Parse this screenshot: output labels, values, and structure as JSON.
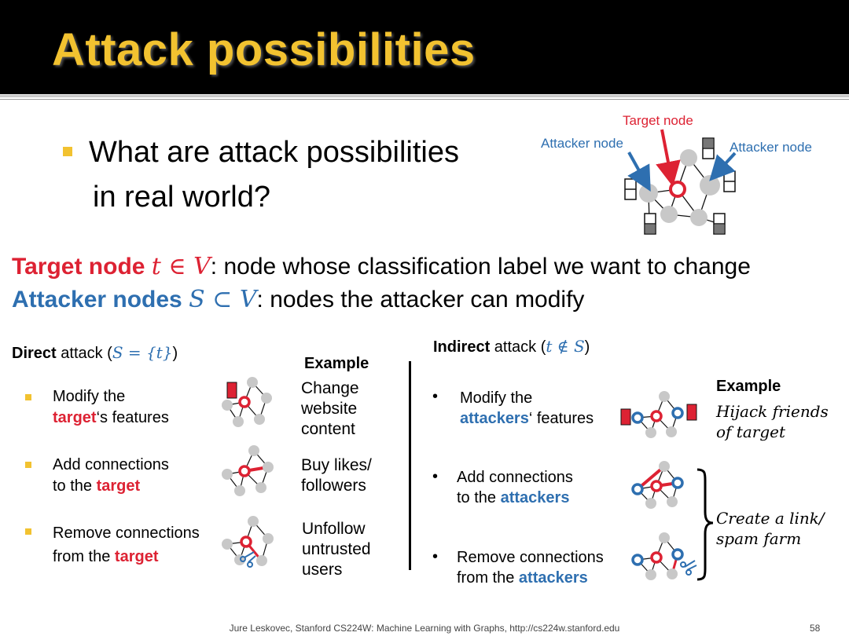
{
  "title": "Attack possibilities",
  "question": {
    "line1": "What are attack possibilities",
    "line2": "in real world?"
  },
  "diagram": {
    "target_label": "Target node",
    "attacker_left": "Attacker node",
    "attacker_right": "Attacker node"
  },
  "definitions": {
    "target": {
      "term": "Target node",
      "math": "t ∈ V",
      "rest": ": node whose classification label we want to change"
    },
    "attacker": {
      "term": "Attacker nodes",
      "math": "S ⊂ V",
      "rest": ": nodes the attacker can modify"
    }
  },
  "direct": {
    "heading_bold": "Direct",
    "heading_rest": " attack (",
    "heading_math": "S = {t}",
    "heading_close": ")",
    "example_header": "Example",
    "items": [
      {
        "pre": "Modify the",
        "hl": "target",
        "post": "‘s features",
        "example": [
          "Change",
          "website",
          "content"
        ]
      },
      {
        "pre": "Add connections",
        "pre2": "to the ",
        "hl": "target",
        "example": [
          "Buy likes/",
          "followers"
        ]
      },
      {
        "pre": "Remove connections",
        "pre2": "from the ",
        "hl": "target",
        "example": [
          "Unfollow",
          "untrusted",
          "users"
        ]
      }
    ]
  },
  "indirect": {
    "heading_bold": "Indirect",
    "heading_rest": " attack (",
    "heading_math": "t ∉ S",
    "heading_close": ")",
    "example_header": "Example",
    "example_1": [
      "Hijack friends",
      "of target"
    ],
    "example_2": [
      "Create a link/",
      "spam farm"
    ],
    "items": [
      {
        "pre": "Modify the",
        "hl": "attackers",
        "post": "‘ features"
      },
      {
        "pre": "Add connections",
        "pre2": "to the ",
        "hl": "attackers"
      },
      {
        "pre": "Remove connections",
        "pre2": "from the ",
        "hl": "attackers"
      }
    ]
  },
  "footer": "Jure Leskovec, Stanford CS224W: Machine Learning with Graphs, http://cs224w.stanford.edu",
  "page_number": "58",
  "colors": {
    "accent": "#f2c230",
    "red": "#dd2233",
    "blue": "#2e6fb0",
    "node": "#c8c8c8"
  }
}
